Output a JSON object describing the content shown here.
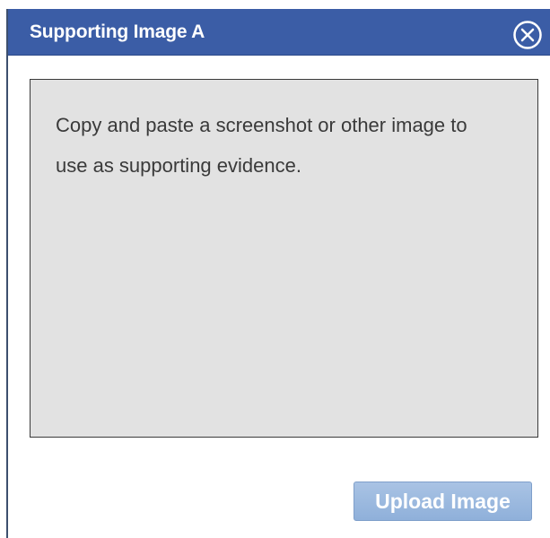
{
  "dialog": {
    "title": "Supporting Image A",
    "close_icon": "close-circle-icon"
  },
  "dropzone": {
    "instructions": "Copy and paste a screenshot or other image to use as supporting evidence."
  },
  "actions": {
    "upload_label": "Upload Image"
  },
  "colors": {
    "titlebar": "#3b5da6",
    "dropzone_bg": "#e2e2e2",
    "upload_button": "#9ab8df"
  }
}
